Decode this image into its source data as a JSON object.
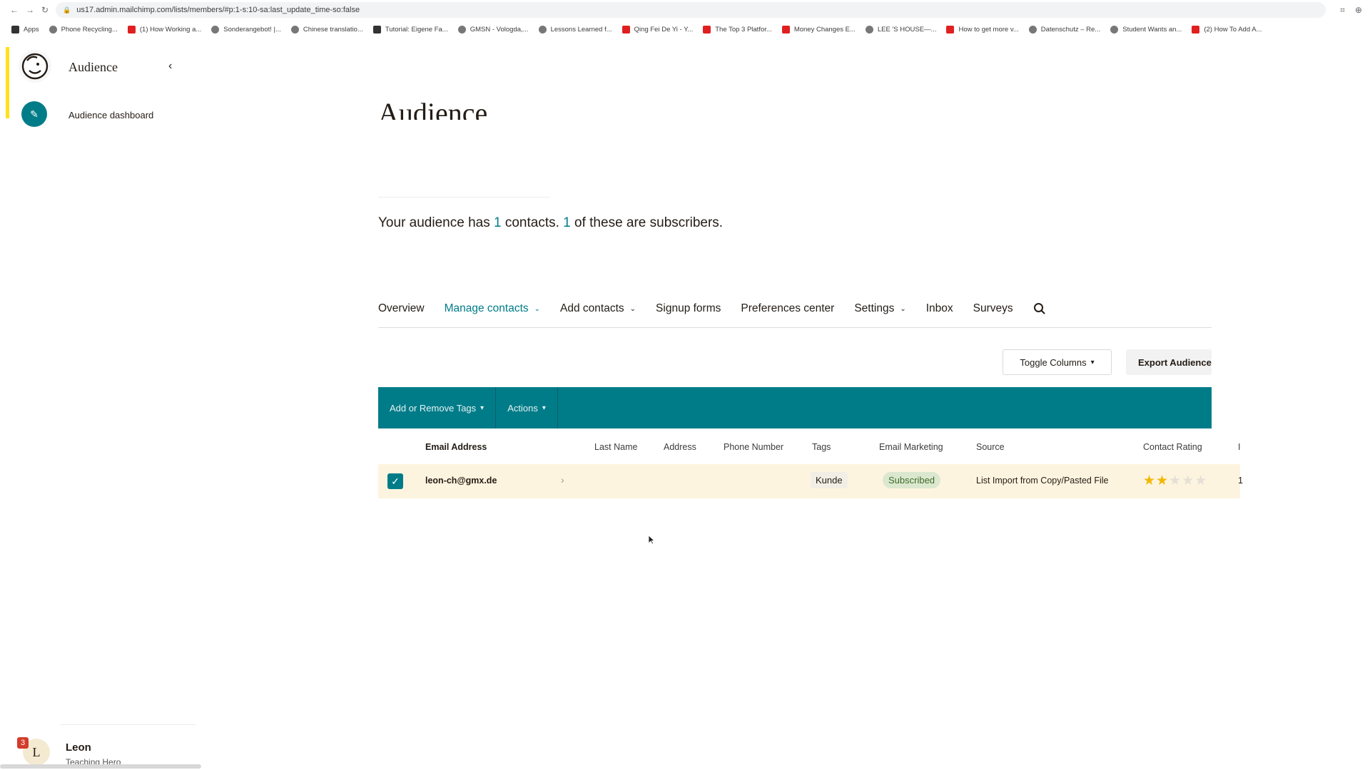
{
  "browser": {
    "url": "us17.admin.mailchimp.com/lists/members/#p:1-s:10-sa:last_update_time-so:false",
    "bookmarks": [
      {
        "label": "Apps",
        "icon": "apps-grid-icon"
      },
      {
        "label": "Phone Recycling...",
        "icon": "search-icon"
      },
      {
        "label": "(1) How Working a...",
        "icon": "youtube-icon"
      },
      {
        "label": "Sonderangebot! |...",
        "icon": "site-icon"
      },
      {
        "label": "Chinese translatio...",
        "icon": "site-icon"
      },
      {
        "label": "Tutorial: Eigene Fa...",
        "icon": "hash-icon"
      },
      {
        "label": "GMSN - Vologda,...",
        "icon": "site-icon"
      },
      {
        "label": "Lessons Learned f...",
        "icon": "site-icon"
      },
      {
        "label": "Qing Fei De Yi - Y...",
        "icon": "youtube-icon"
      },
      {
        "label": "The Top 3 Platfor...",
        "icon": "youtube-icon"
      },
      {
        "label": "Money Changes E...",
        "icon": "youtube-icon"
      },
      {
        "label": "LEE 'S HOUSE—...",
        "icon": "site-icon"
      },
      {
        "label": "How to get more v...",
        "icon": "youtube-icon"
      },
      {
        "label": "Datenschutz – Re...",
        "icon": "site-icon"
      },
      {
        "label": "Student Wants an...",
        "icon": "site-icon"
      },
      {
        "label": "(2) How To Add A...",
        "icon": "youtube-icon"
      }
    ]
  },
  "sidebar": {
    "title": "Audience",
    "items": [
      {
        "label": "Audience dashboard",
        "icon": "pencil-icon"
      }
    ],
    "user": {
      "initial": "L",
      "name": "Leon",
      "role": "Teaching Hero",
      "notifications": "3"
    }
  },
  "main": {
    "title": "Audience",
    "summary": {
      "prefix": "Your audience has ",
      "contacts": "1",
      "middle": " contacts. ",
      "subscribers": "1",
      "suffix": " of these are subscribers."
    },
    "tabs": [
      {
        "label": "Overview",
        "active": false,
        "dropdown": false
      },
      {
        "label": "Manage contacts",
        "active": true,
        "dropdown": true
      },
      {
        "label": "Add contacts",
        "active": false,
        "dropdown": true
      },
      {
        "label": "Signup forms",
        "active": false,
        "dropdown": false
      },
      {
        "label": "Preferences center",
        "active": false,
        "dropdown": false
      },
      {
        "label": "Settings",
        "active": false,
        "dropdown": true
      },
      {
        "label": "Inbox",
        "active": false,
        "dropdown": false
      },
      {
        "label": "Surveys",
        "active": false,
        "dropdown": false
      }
    ],
    "toggle_columns_label": "Toggle Columns",
    "export_label": "Export Audience",
    "actionbar": {
      "tags_label": "Add or Remove Tags",
      "actions_label": "Actions"
    },
    "table": {
      "columns": [
        "Email Address",
        "Last Name",
        "Address",
        "Phone Number",
        "Tags",
        "Email Marketing",
        "Source",
        "Contact Rating",
        "I"
      ],
      "rows": [
        {
          "checked": true,
          "email": "leon-ch@gmx.de",
          "last_name": "",
          "address": "",
          "phone": "",
          "tag": "Kunde",
          "email_marketing": "Subscribed",
          "source": "List Import from Copy/Pasted File",
          "rating": 2,
          "rating_max": 5,
          "extra": "1"
        }
      ]
    }
  },
  "colors": {
    "accent": "#007c89",
    "highlight_row": "#fdf4df",
    "star": "#f2b705",
    "brand_yellow": "#ffe01b"
  }
}
